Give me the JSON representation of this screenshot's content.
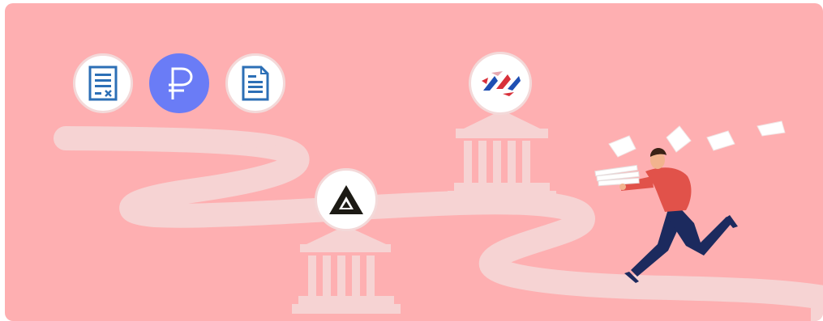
{
  "banner": {
    "background_color": "#feafb1",
    "road_color": "#f6d3d3",
    "bank_color": "#f6d3d3"
  },
  "icons": [
    {
      "name": "tax-document-icon",
      "style": "white"
    },
    {
      "name": "ruble-icon",
      "style": "blue",
      "color": "#6a7cf6"
    },
    {
      "name": "document-icon",
      "style": "white"
    },
    {
      "name": "bank-logo-icon",
      "style": "white"
    },
    {
      "name": "triangle-logo-icon",
      "style": "white"
    }
  ],
  "person": {
    "shirt_color": "#e1524a",
    "pants_color": "#1c2a5e"
  }
}
